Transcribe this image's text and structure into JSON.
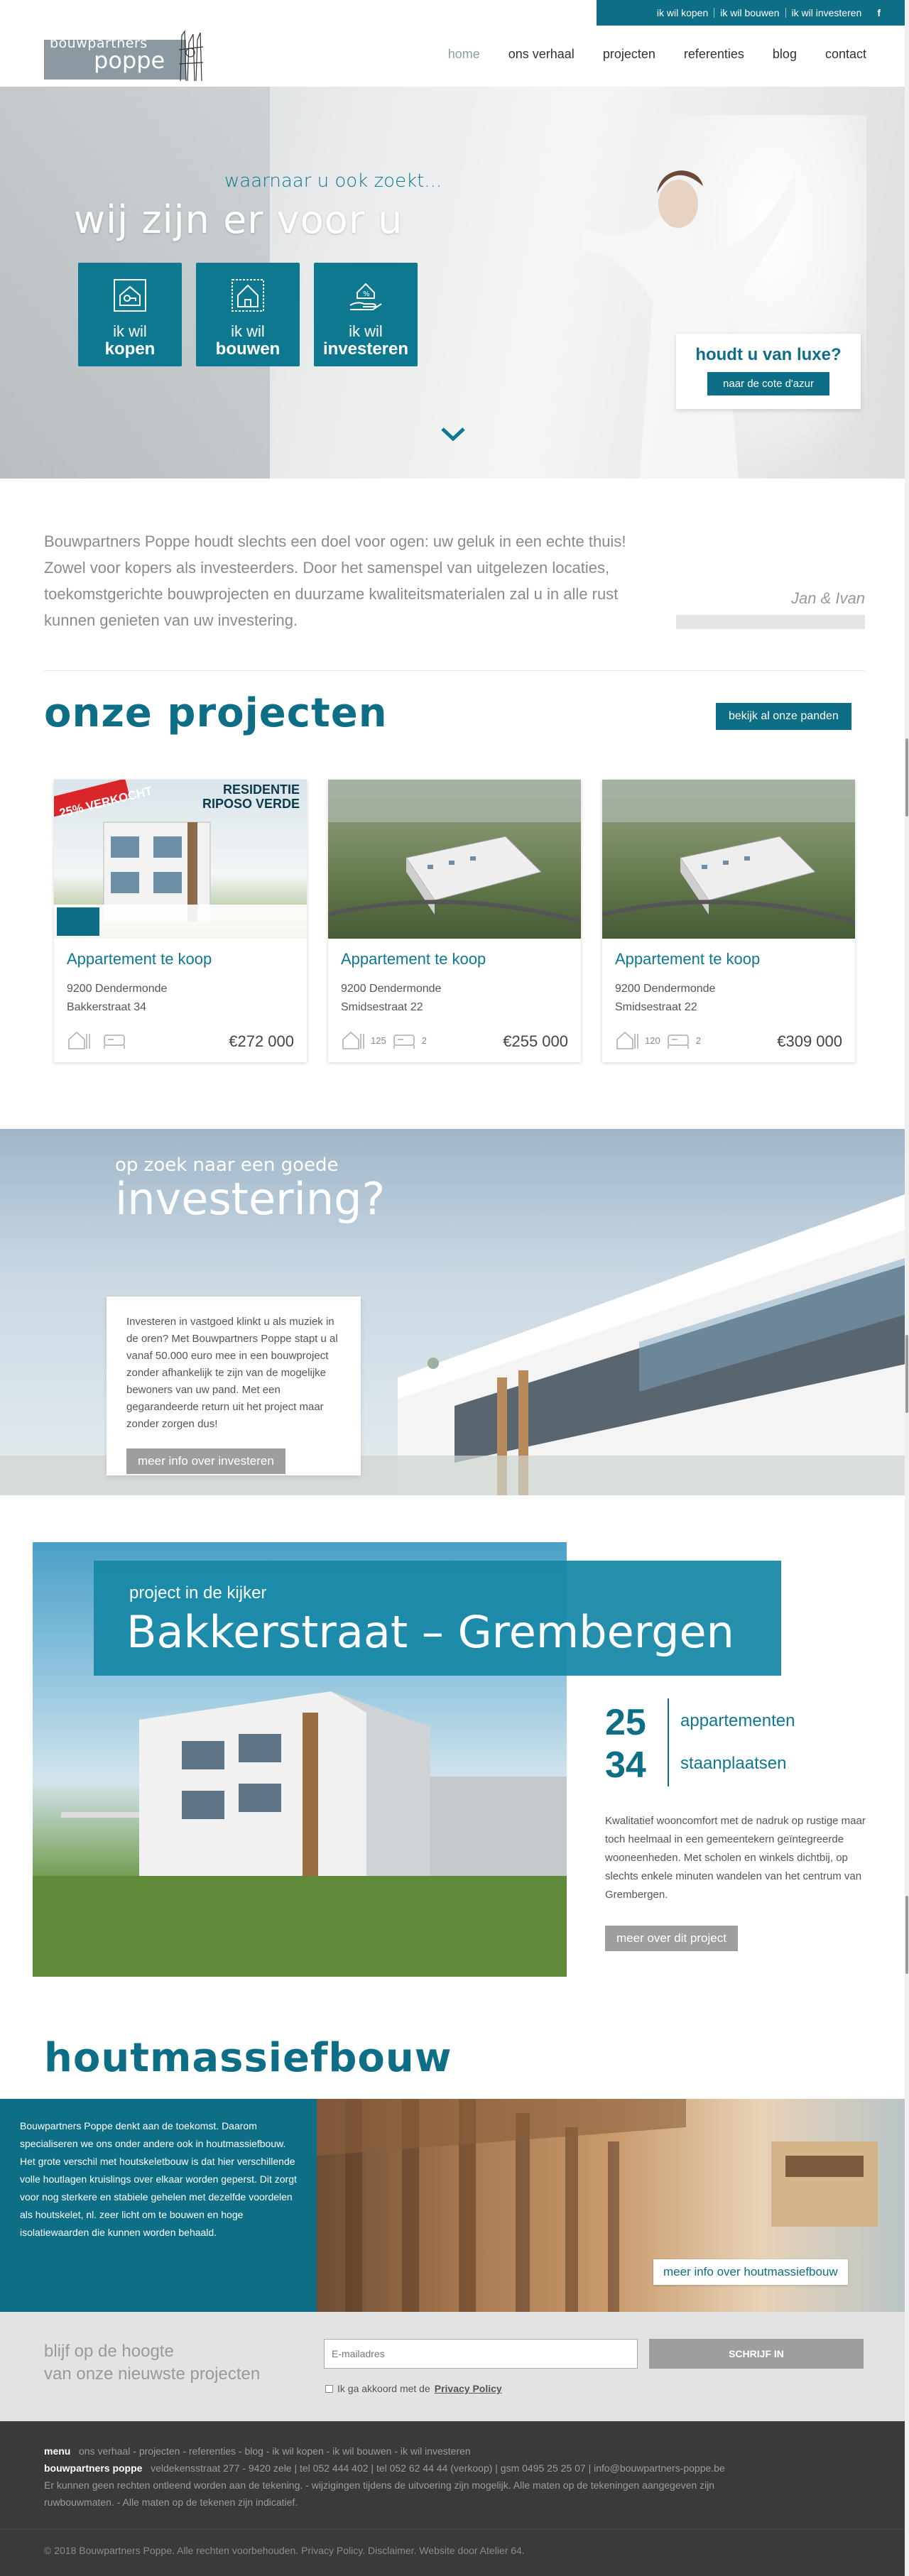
{
  "topbar": {
    "links": [
      "ik wil kopen",
      "ik wil bouwen",
      "ik wil investeren"
    ],
    "facebook": "f"
  },
  "logo": {
    "top": "bouwpartners",
    "main": "poppe"
  },
  "nav": [
    "home",
    "ons verhaal",
    "projecten",
    "referenties",
    "blog",
    "contact"
  ],
  "hero": {
    "subtitle": "waarnaar u ook zoekt...",
    "title": "wij zijn er voor u",
    "tiles": [
      {
        "line1": "ik wil",
        "line2": "kopen",
        "icon": "house-key-icon"
      },
      {
        "line1": "ik wil",
        "line2": "bouwen",
        "icon": "house-blueprint-icon"
      },
      {
        "line1": "ik wil",
        "line2": "investeren",
        "icon": "hand-money-icon"
      }
    ],
    "luxe_question": "houdt u van luxe?",
    "luxe_button": "naar de cote d'azur"
  },
  "intro": {
    "text": "Bouwpartners Poppe houdt slechts een doel voor ogen: uw geluk in een echte thuis! Zowel voor kopers als investeerders. Door het samenspel van uitgelezen locaties, toekomstgerichte bouwprojecten en duurzame kwaliteitsmaterialen zal u in alle rust kunnen genieten van uw investering.",
    "signature": "Jan & Ivan"
  },
  "projects": {
    "title": "onze projecten",
    "button": "bekijk al onze panden",
    "cards": [
      {
        "title": "Appartement te koop",
        "city": "9200 Dendermonde",
        "street": "Bakkerstraat 34",
        "area": "",
        "rooms": "",
        "price": "€272 000",
        "banner": "25% VERKOCHT",
        "residence": "RESIDENTIE\nRIPOSO VERDE"
      },
      {
        "title": "Appartement te koop",
        "city": "9200 Dendermonde",
        "street": "Smidsestraat 22",
        "area": "125",
        "rooms": "2",
        "price": "€255 000"
      },
      {
        "title": "Appartement te koop",
        "city": "9200 Dendermonde",
        "street": "Smidsestraat 22",
        "area": "120",
        "rooms": "2",
        "price": "€309 000"
      }
    ]
  },
  "invest": {
    "subtitle": "op zoek naar een goede",
    "title": "investering?",
    "text": "Investeren in vastgoed klinkt u als muziek in de oren? Met Bouwpartners Poppe stapt u al vanaf 50.000 euro mee in een bouwproject zonder afhankelijk te zijn van de mogelijke bewoners van uw pand. Met een gegarandeerde return uit het project maar zonder zorgen dus!",
    "button": "meer info over investeren"
  },
  "kijker": {
    "subtitle": "project in de kijker",
    "title": "Bakkerstraat – Grembergen",
    "stats": [
      {
        "num": "25",
        "label": "appartementen"
      },
      {
        "num": "34",
        "label": "staanplaatsen"
      }
    ],
    "text": "Kwalitatief wooncomfort met de nadruk op rustige maar toch heelmaal in een gemeentekern geïntegreerde wooneenheden. Met scholen en winkels dichtbij, op slechts enkele minuten wandelen van het centrum van Grembergen.",
    "button": "meer over dit project"
  },
  "hout": {
    "title": "houtmassiefbouw",
    "text": "Bouwpartners Poppe denkt aan de toekomst. Daarom specialiseren we ons onder andere ook in houtmassiefbouw. Het grote verschil met houtskeletbouw is dat hier verschillende volle houtlagen kruislings over elkaar worden geperst. Dit zorgt voor nog sterkere en stabiele gehelen met dezelfde voordelen als houtskelet, nl. zeer licht om te bouwen en hoge isolatiewaarden die kunnen worden behaald.",
    "button": "meer info over houtmassiefbouw"
  },
  "newsletter": {
    "title_line1": "blijf op de hoogte",
    "title_line2": "van onze nieuwste projecten",
    "placeholder": "E-mailadres",
    "button": "SCHRIJF IN",
    "agree_prefix": "Ik ga akkoord met de",
    "agree_link": "Privacy Policy"
  },
  "footer": {
    "menu_label": "menu",
    "menu_items": "ons verhaal - projecten - referenties - blog - ik wil kopen - ik wil bouwen - ik wil investeren",
    "company_label": "bouwpartners poppe",
    "company_info": "veldekensstraat 277 - 9420 zele | tel 052 444 402 | tel 052 62 44 44 (verkoop) | gsm 0495 25 25 07 | info@bouwpartners-poppe.be",
    "disclaimer_line1": "Er kunnen geen rechten ontleend worden aan de tekening. - wijzigingen tijdens de uitvoering zijn mogelijk. Alle maten op de tekeningen aangegeven zijn",
    "disclaimer_line2": "ruwbouwmaten. - Alle maten op de tekenen zijn indicatief.",
    "copyright": "© 2018 Bouwpartners Poppe. Alle rechten voorbehouden. Privacy Policy. Disclaimer. Website door Atelier 64."
  },
  "colors": {
    "primary": "#0e6e86",
    "accent": "#1888a6",
    "grey_button": "#9e9e9e",
    "footer": "#3a3a3a"
  }
}
